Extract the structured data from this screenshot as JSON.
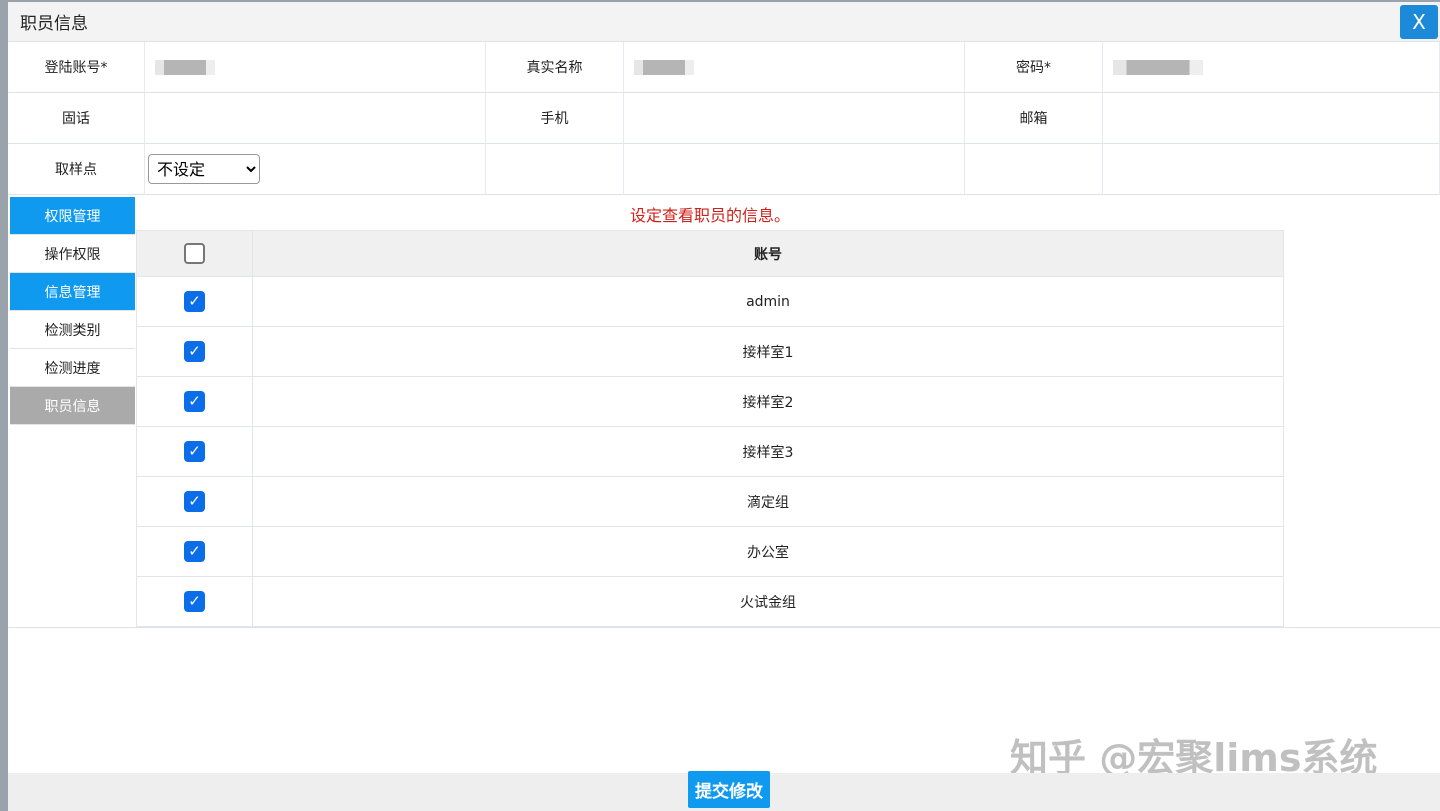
{
  "title": "职员信息",
  "close_label": "X",
  "form": {
    "login_label": "登陆账号*",
    "realname_label": "真实名称",
    "password_label": "密码*",
    "phone_label": "固话",
    "mobile_label": "手机",
    "email_label": "邮箱",
    "sample_label": "取样点",
    "sample_value": "不设定"
  },
  "sidebar": [
    {
      "label": "权限管理",
      "style": "blue"
    },
    {
      "label": "操作权限",
      "style": "plain"
    },
    {
      "label": "信息管理",
      "style": "blue"
    },
    {
      "label": "检测类别",
      "style": "plain"
    },
    {
      "label": "检测进度",
      "style": "plain"
    },
    {
      "label": "职员信息",
      "style": "grey"
    }
  ],
  "message": "设定查看职员的信息。",
  "table": {
    "header": "账号",
    "rows": [
      {
        "name": "admin",
        "checked": true
      },
      {
        "name": "接样室1",
        "checked": true
      },
      {
        "name": "接样室2",
        "checked": true
      },
      {
        "name": "接样室3",
        "checked": true
      },
      {
        "name": "滴定组",
        "checked": true
      },
      {
        "name": "办公室",
        "checked": true
      },
      {
        "name": "火试金组",
        "checked": true
      }
    ]
  },
  "submit_label": "提交修改",
  "watermark": "知乎 @宏聚lims系统"
}
